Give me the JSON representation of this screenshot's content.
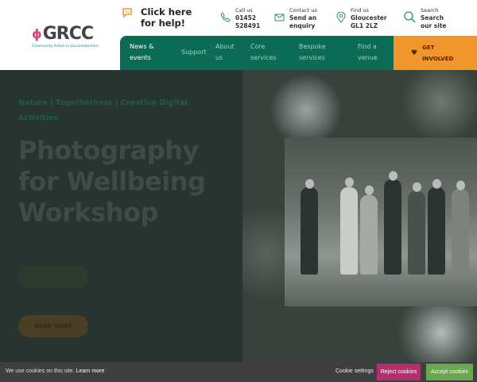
{
  "header": {
    "logo": {
      "text": "GRCC",
      "tagline": "Community Action in Gloucestershire"
    },
    "help": "Click here for help!",
    "contacts": [
      {
        "label": "Call us",
        "value": "01452 528491",
        "icon": "phone-icon"
      },
      {
        "label": "Contact us",
        "value": "Send an enquiry",
        "icon": "envelope-icon"
      },
      {
        "label": "Find us",
        "value": "Gloucester GL1 2LZ",
        "icon": "map-pin-icon"
      },
      {
        "label": "Search",
        "value": "Search our site",
        "icon": "search-icon"
      }
    ]
  },
  "nav": {
    "items": [
      "News & events",
      "Support",
      "About us",
      "Core services",
      "Bespoke services",
      "Find a venue"
    ],
    "cta": "GET INVOLVED"
  },
  "hero": {
    "tags": "Nature | Togetherness | Creative Digital Activities",
    "title": "Photography for Wellbeing Workshop",
    "button": "READ MORE"
  },
  "cookie": {
    "message": "We use cookies on this site.",
    "learn_more": "Learn more",
    "settings": "Cookie settings",
    "reject": "Reject cookies",
    "accept": "Accept cookies"
  },
  "colors": {
    "nav": "#0b6b55",
    "cta": "#f0962a",
    "reject": "#b3306f",
    "accept": "#6aa84f"
  }
}
